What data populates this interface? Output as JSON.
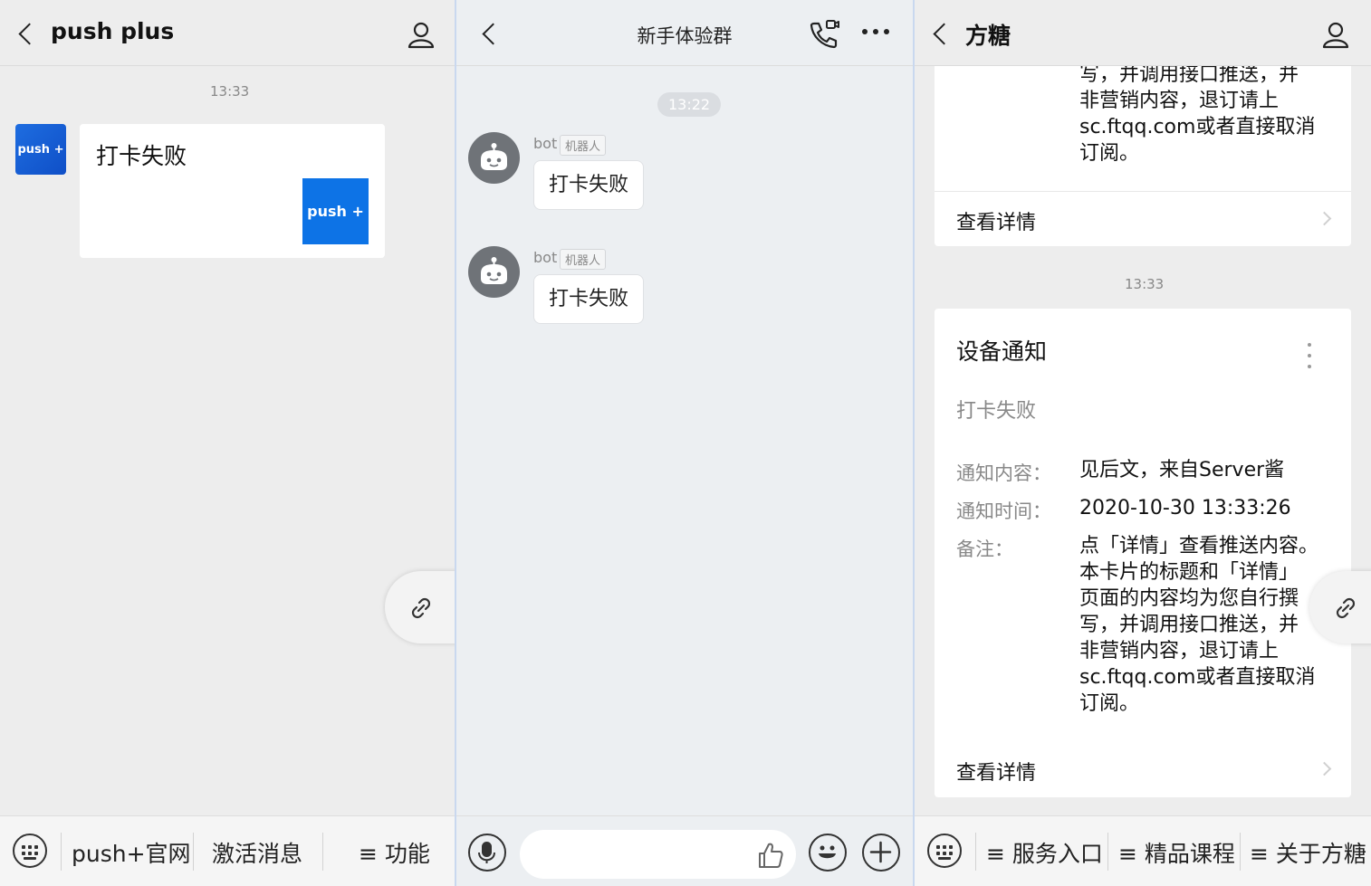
{
  "panel1": {
    "title": "push plus",
    "time": "13:33",
    "avatar_text": "push +",
    "message": "打卡失败",
    "thumb_text": "push +",
    "footer": {
      "btn1": "push+官网",
      "btn2": "激活消息",
      "btn3": "≡ 功能"
    }
  },
  "panel2": {
    "title": "新手体验群",
    "time": "13:22",
    "messages": [
      {
        "sender": "bot",
        "tag": "机器人",
        "text": "打卡失败"
      },
      {
        "sender": "bot",
        "tag": "机器人",
        "text": "打卡失败"
      }
    ]
  },
  "panel3": {
    "title": "方糖",
    "top_lines": [
      "写，并调用接口推送，并",
      "非营销内容，退订请上",
      "sc.ftqq.com或者直接取消",
      "订阅。"
    ],
    "detail_label": "查看详情",
    "time": "13:33",
    "card": {
      "title": "设备通知",
      "subtitle": "打卡失败",
      "fields": [
        {
          "label": "通知内容：",
          "value": "见后文，来自Server酱"
        },
        {
          "label": "通知时间：",
          "value": "2020-10-30 13:33:26"
        }
      ],
      "note_label": "备注：",
      "note_lines": [
        "点「详情」查看推送内容。",
        "本卡片的标题和「详情」",
        "页面的内容均为您自行撰",
        "写，并调用接口推送，并",
        "非营销内容，退订请上",
        "sc.ftqq.com或者直接取消",
        "订阅。"
      ],
      "detail_label": "查看详情"
    },
    "footer": {
      "btn1": "≡ 服务入口",
      "btn2": "≡ 精品课程",
      "btn3": "≡ 关于方糖"
    }
  }
}
